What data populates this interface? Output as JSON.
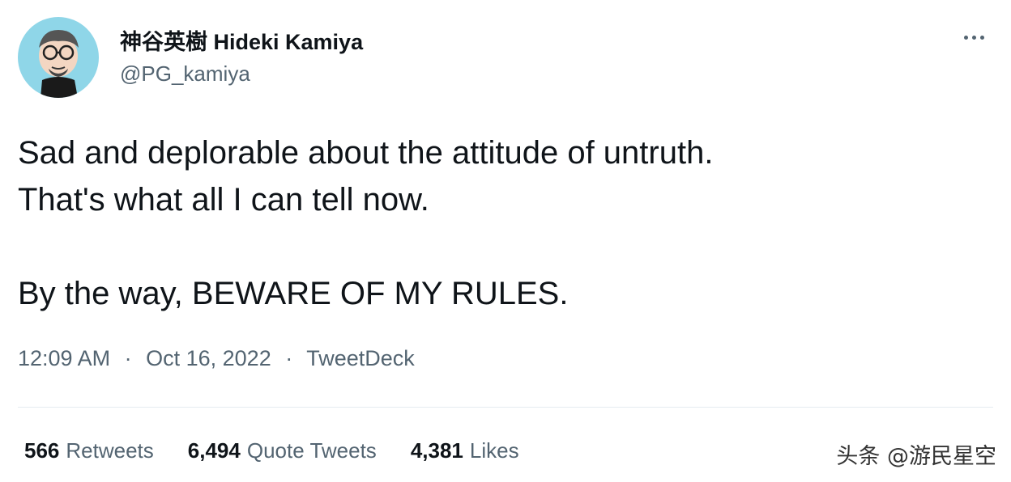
{
  "author": {
    "display_name": "神谷英樹 Hideki Kamiya",
    "handle": "@PG_kamiya",
    "avatar_icon": "cartoon-avatar-icon"
  },
  "tweet": {
    "lines": [
      "Sad and deplorable about the attitude of untruth.",
      "That's what all I can tell now.",
      "By the way, BEWARE OF MY RULES."
    ],
    "time": "12:09 AM",
    "date": "Oct 16, 2022",
    "source": "TweetDeck",
    "separator": "·"
  },
  "stats": {
    "retweets_count": "566",
    "retweets_label": "Retweets",
    "quote_count": "6,494",
    "quote_label": "Quote Tweets",
    "likes_count": "4,381",
    "likes_label": "Likes"
  },
  "watermark": "头条 @游民星空",
  "icons": {
    "more": "more-options-icon"
  },
  "colors": {
    "text": "#0f1419",
    "secondary": "#536471",
    "avatar_bg": "#8fd6e8"
  }
}
